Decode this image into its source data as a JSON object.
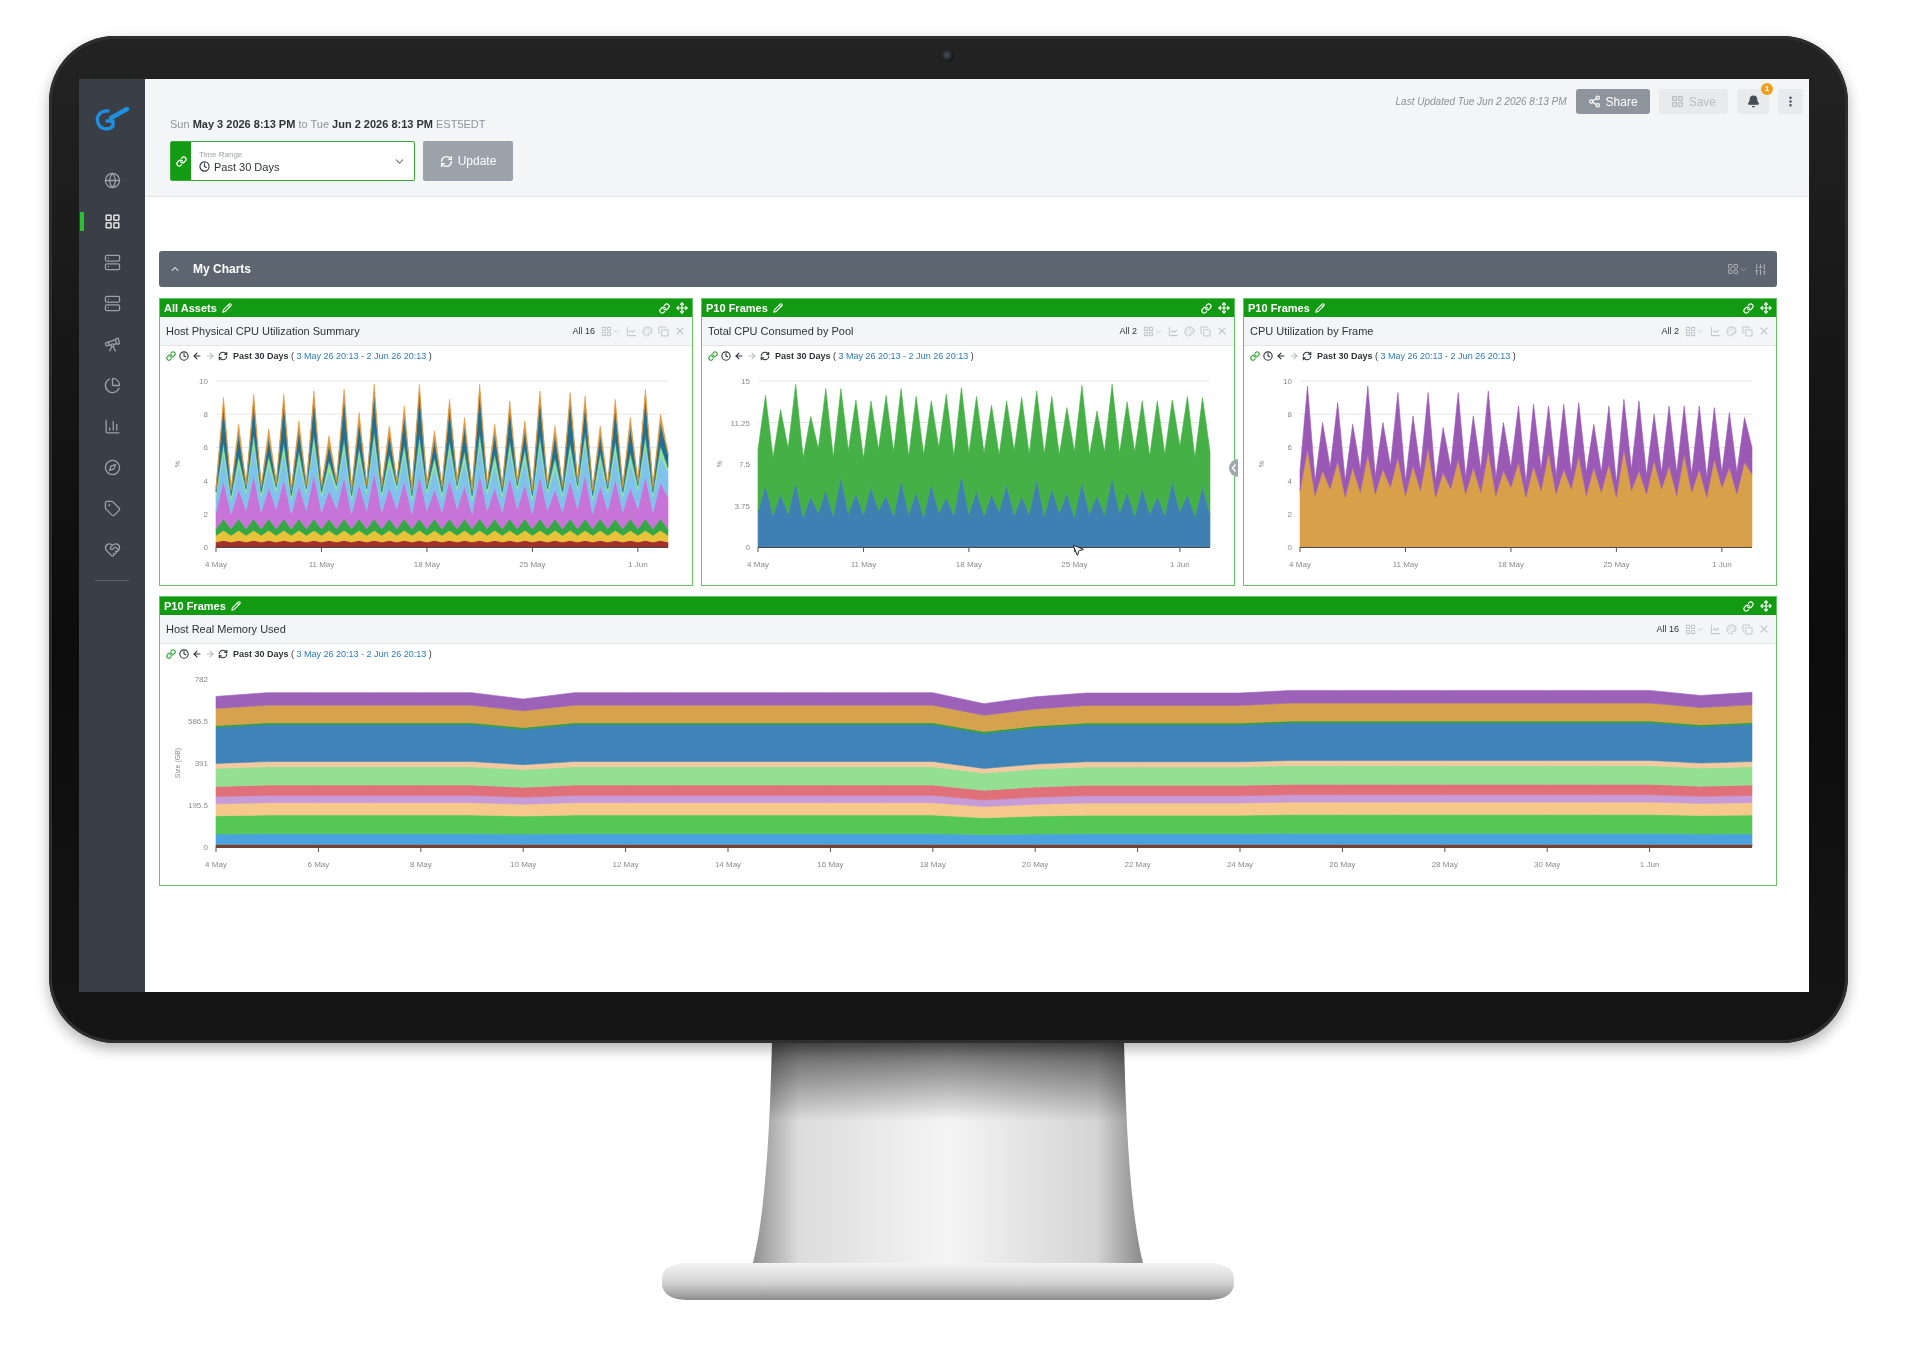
{
  "sidebar": {
    "items": [
      {
        "selected": false
      },
      {
        "selected": true
      },
      {
        "selected": false
      },
      {
        "selected": false
      },
      {
        "selected": false
      },
      {
        "selected": false
      },
      {
        "selected": false
      },
      {
        "selected": false
      },
      {
        "selected": false
      },
      {
        "selected": false
      }
    ]
  },
  "header": {
    "range_line": "Sun **May 3 2026 8:13 PM** to Tue **Jun 2 2026 8:13 PM** EST5EDT",
    "time_range": {
      "label": "Time Range",
      "value": "Past 30 Days"
    },
    "update_button": "Update",
    "last_updated": "Last Updated Tue Jun 2 2026 8:13 PM",
    "actions": [
      {
        "kind": "share",
        "label": "Share",
        "disabled": false
      },
      {
        "kind": "save",
        "label": "Save",
        "disabled": true
      }
    ],
    "notifications": {
      "count": "1"
    }
  },
  "section": {
    "title": "My Charts",
    "expanded": true
  },
  "panel_rows": [
    {
      "panels": [
        {
          "group": "All Assets",
          "title": "Host Physical CPU Utilization Summary",
          "filter": "All 16",
          "toolbar": {
            "period": "Past 30 Days",
            "brackets": [
              "(",
              ")"
            ],
            "dates": "3 May 26 20:13 - 2 Jun 26 20:13"
          },
          "chart_data": {
            "type": "area",
            "stacked": true,
            "grid": true,
            "ylabel": "%",
            "categories": [
              "4 May",
              null,
              null,
              null,
              null,
              null,
              null,
              null,
              null,
              null,
              null,
              null,
              null,
              null,
              "11 May",
              null,
              null,
              null,
              null,
              null,
              null,
              null,
              null,
              null,
              null,
              null,
              null,
              null,
              "18 May",
              null,
              null,
              null,
              null,
              null,
              null,
              null,
              null,
              null,
              null,
              null,
              null,
              null,
              "25 May",
              null,
              null,
              null,
              null,
              null,
              null,
              null,
              null,
              null,
              null,
              null,
              null,
              null,
              "1 Jun",
              null,
              null,
              null,
              null
            ],
            "ylim": [
              0,
              10
            ],
            "yticks": [
              0,
              2,
              4,
              6,
              8,
              10
            ],
            "series": [
              {
                "color": "#a3302a",
                "values": [
                  0.3,
                  0.4,
                  0.3,
                  0.4,
                  0.3,
                  0.4,
                  0.3,
                  0.4,
                  0.3,
                  0.4,
                  0.3,
                  0.4,
                  0.3,
                  0.4,
                  0.3,
                  0.4,
                  0.3,
                  0.4,
                  0.3,
                  0.4,
                  0.3,
                  0.4,
                  0.3,
                  0.4,
                  0.3,
                  0.4,
                  0.3,
                  0.4,
                  0.3,
                  0.4,
                  0.3,
                  0.4,
                  0.3,
                  0.4,
                  0.3,
                  0.4,
                  0.3,
                  0.4,
                  0.3,
                  0.4,
                  0.3,
                  0.4,
                  0.3,
                  0.4,
                  0.3,
                  0.4,
                  0.3,
                  0.4,
                  0.3,
                  0.4,
                  0.3,
                  0.4,
                  0.3,
                  0.4,
                  0.3,
                  0.4,
                  0.3,
                  0.4,
                  0.3,
                  0.4,
                  0.3
                ]
              },
              {
                "color": "#e8c33a",
                "values": [
                  0.4,
                  0.6,
                  0.4,
                  0.6,
                  0.4,
                  0.6,
                  0.4,
                  0.6,
                  0.4,
                  0.6,
                  0.4,
                  0.6,
                  0.4,
                  0.6,
                  0.4,
                  0.6,
                  0.4,
                  0.6,
                  0.4,
                  0.6,
                  0.4,
                  0.6,
                  0.4,
                  0.6,
                  0.4,
                  0.6,
                  0.4,
                  0.6,
                  0.4,
                  0.6,
                  0.4,
                  0.6,
                  0.4,
                  0.6,
                  0.4,
                  0.6,
                  0.4,
                  0.6,
                  0.4,
                  0.6,
                  0.4,
                  0.6,
                  0.4,
                  0.6,
                  0.4,
                  0.6,
                  0.4,
                  0.6,
                  0.4,
                  0.6,
                  0.4,
                  0.6,
                  0.4,
                  0.6,
                  0.4,
                  0.6,
                  0.4,
                  0.6,
                  0.4,
                  0.6,
                  0.4
                ]
              },
              {
                "color": "#35a845",
                "values": [
                  0.4,
                  0.7,
                  0.4,
                  0.7,
                  0.4,
                  0.7,
                  0.4,
                  0.7,
                  0.4,
                  0.7,
                  0.4,
                  0.7,
                  0.4,
                  0.7,
                  0.4,
                  0.7,
                  0.4,
                  0.7,
                  0.4,
                  0.7,
                  0.4,
                  0.7,
                  0.4,
                  0.7,
                  0.4,
                  0.7,
                  0.4,
                  0.7,
                  0.4,
                  0.7,
                  0.4,
                  0.7,
                  0.4,
                  0.7,
                  0.4,
                  0.7,
                  0.4,
                  0.7,
                  0.4,
                  0.7,
                  0.4,
                  0.7,
                  0.4,
                  0.7,
                  0.4,
                  0.7,
                  0.4,
                  0.7,
                  0.4,
                  0.7,
                  0.4,
                  0.7,
                  0.4,
                  0.7,
                  0.4,
                  0.7,
                  0.4,
                  0.7,
                  0.4,
                  0.7,
                  0.4
                ]
              },
              {
                "color": "#c873d8",
                "values": [
                  1.0,
                  2.3,
                  0.9,
                  1.8,
                  1.1,
                  2.6,
                  1.0,
                  1.9,
                  1.2,
                  2.4,
                  0.9,
                  2.0,
                  1.1,
                  2.7,
                  1.0,
                  1.7,
                  1.2,
                  2.5,
                  0.9,
                  2.1,
                  1.1,
                  2.8,
                  1.0,
                  1.9,
                  1.2,
                  2.3,
                  0.9,
                  2.6,
                  1.1,
                  1.8,
                  1.0,
                  2.4,
                  1.2,
                  2.0,
                  0.9,
                  2.7,
                  1.1,
                  1.9,
                  1.0,
                  2.5,
                  1.2,
                  2.1,
                  0.9,
                  2.6,
                  1.1,
                  1.8,
                  1.0,
                  2.3,
                  1.2,
                  2.7,
                  0.9,
                  2.0,
                  1.1,
                  2.4,
                  1.0,
                  1.9,
                  1.2,
                  2.6,
                  1.0,
                  2.2,
                  1.9
                ]
              },
              {
                "color": "#7fc3ec",
                "values": [
                  0.9,
                  1.7,
                  0.8,
                  1.4,
                  1.0,
                  1.9,
                  0.9,
                  1.3,
                  1.0,
                  1.6,
                  0.8,
                  1.5,
                  1.0,
                  1.8,
                  0.9,
                  1.2,
                  1.1,
                  1.7,
                  0.8,
                  1.6,
                  1.0,
                  1.9,
                  0.9,
                  1.4,
                  1.1,
                  1.6,
                  0.8,
                  1.8,
                  1.0,
                  1.3,
                  0.9,
                  1.7,
                  1.1,
                  1.5,
                  0.8,
                  1.9,
                  1.0,
                  1.4,
                  0.9,
                  1.6,
                  1.1,
                  1.5,
                  0.8,
                  1.8,
                  1.0,
                  1.3,
                  0.9,
                  1.7,
                  1.1,
                  1.9,
                  0.8,
                  1.4,
                  1.0,
                  1.7,
                  0.9,
                  1.5,
                  1.1,
                  1.8,
                  0.9,
                  1.6,
                  1.5
                ]
              },
              {
                "color": "#93e29a",
                "values": [
                  0.3,
                  0.6,
                  0.3,
                  0.6,
                  0.3,
                  0.6,
                  0.3,
                  0.6,
                  0.3,
                  0.6,
                  0.3,
                  0.6,
                  0.3,
                  0.6,
                  0.3,
                  0.6,
                  0.3,
                  0.6,
                  0.3,
                  0.6,
                  0.3,
                  0.6,
                  0.3,
                  0.6,
                  0.3,
                  0.6,
                  0.3,
                  0.6,
                  0.3,
                  0.6,
                  0.3,
                  0.6,
                  0.3,
                  0.6,
                  0.3,
                  0.6,
                  0.3,
                  0.6,
                  0.3,
                  0.6,
                  0.3,
                  0.6,
                  0.3,
                  0.6,
                  0.3,
                  0.6,
                  0.3,
                  0.6,
                  0.3,
                  0.6,
                  0.3,
                  0.6,
                  0.3,
                  0.6,
                  0.3,
                  0.6,
                  0.3,
                  0.6,
                  0.3,
                  0.6,
                  0.3
                ]
              },
              {
                "color": "#22708f",
                "values": [
                  0.2,
                  2.2,
                  0.3,
                  1.4,
                  0.2,
                  1.9,
                  0.3,
                  1.1,
                  0.2,
                  2.4,
                  0.3,
                  1.3,
                  0.2,
                  2.1,
                  0.3,
                  1.0,
                  0.2,
                  2.5,
                  0.3,
                  1.6,
                  0.2,
                  2.3,
                  0.3,
                  1.2,
                  0.2,
                  1.8,
                  0.3,
                  2.6,
                  0.2,
                  1.1,
                  0.3,
                  2.0,
                  0.2,
                  1.5,
                  0.3,
                  2.4,
                  0.2,
                  1.3,
                  0.3,
                  1.9,
                  0.2,
                  1.2,
                  0.3,
                  2.2,
                  0.2,
                  1.4,
                  0.3,
                  2.5,
                  0.2,
                  1.7,
                  0.3,
                  1.1,
                  0.2,
                  2.0,
                  0.3,
                  1.6,
                  0.2,
                  2.3,
                  0.3,
                  1.4,
                  0.8
                ]
              },
              {
                "color": "#e2973d",
                "values": [
                  0.1,
                  0.5,
                  0.1,
                  0.5,
                  0.1,
                  0.5,
                  0.1,
                  0.5,
                  0.1,
                  0.5,
                  0.1,
                  0.5,
                  0.1,
                  0.5,
                  0.1,
                  0.5,
                  0.1,
                  0.5,
                  0.1,
                  0.5,
                  0.1,
                  0.5,
                  0.1,
                  0.5,
                  0.1,
                  0.5,
                  0.1,
                  0.5,
                  0.1,
                  0.5,
                  0.1,
                  0.5,
                  0.1,
                  0.5,
                  0.1,
                  0.5,
                  0.1,
                  0.5,
                  0.1,
                  0.5,
                  0.1,
                  0.5,
                  0.1,
                  0.5,
                  0.1,
                  0.5,
                  0.1,
                  0.5,
                  0.1,
                  0.5,
                  0.1,
                  0.5,
                  0.1,
                  0.5,
                  0.1,
                  0.5,
                  0.1,
                  0.5,
                  0.1,
                  0.5,
                  0.1
                ]
              }
            ]
          }
        },
        {
          "group": "P10 Frames",
          "title": "Total CPU Consumed by Pool",
          "filter": "All 2",
          "toolbar": {
            "period": "Past 30 Days",
            "brackets": [
              "(",
              ")"
            ],
            "dates": "3 May 26 20:13 - 2 Jun 26 20:13"
          },
          "chart_data": {
            "type": "area",
            "stacked": true,
            "grid": true,
            "ylabel": "%",
            "categories": [
              "4 May",
              null,
              null,
              null,
              null,
              null,
              null,
              null,
              null,
              null,
              null,
              null,
              null,
              null,
              "11 May",
              null,
              null,
              null,
              null,
              null,
              null,
              null,
              null,
              null,
              null,
              null,
              null,
              null,
              "18 May",
              null,
              null,
              null,
              null,
              null,
              null,
              null,
              null,
              null,
              null,
              null,
              null,
              null,
              "25 May",
              null,
              null,
              null,
              null,
              null,
              null,
              null,
              null,
              null,
              null,
              null,
              null,
              null,
              "1 Jun",
              null,
              null,
              null,
              null
            ],
            "ylim": [
              0,
              15
            ],
            "yticks": [
              0,
              3.75,
              7.5,
              11.25,
              15
            ],
            "series": [
              {
                "color": "#3f80b3",
                "values": [
                  3.2,
                  5.6,
                  2.9,
                  4.8,
                  3.0,
                  5.9,
                  2.7,
                  4.6,
                  3.1,
                  5.2,
                  2.8,
                  6.4,
                  3.0,
                  4.9,
                  2.9,
                  5.5,
                  3.3,
                  4.7,
                  2.8,
                  6.1,
                  3.0,
                  5.0,
                  2.7,
                  5.8,
                  3.1,
                  4.5,
                  2.9,
                  6.6,
                  3.0,
                  5.1,
                  2.8,
                  4.8,
                  3.2,
                  5.7,
                  2.9,
                  4.6,
                  3.0,
                  6.2,
                  2.8,
                  5.3,
                  3.1,
                  4.9,
                  2.7,
                  5.9,
                  3.0,
                  4.7,
                  2.9,
                  6.3,
                  3.1,
                  5.0,
                  2.8,
                  5.4,
                  3.0,
                  4.6,
                  2.9,
                  6.0,
                  3.2,
                  4.8,
                  2.8,
                  5.5,
                  3.0
                ]
              },
              {
                "color": "#45b045",
                "values": [
                  5.6,
                  8.1,
                  5.2,
                  7.6,
                  5.9,
                  8.8,
                  5.4,
                  7.2,
                  5.8,
                  9.1,
                  5.3,
                  7.9,
                  5.7,
                  8.4,
                  5.1,
                  7.7,
                  5.5,
                  9.0,
                  5.8,
                  8.2,
                  5.2,
                  8.6,
                  5.6,
                  7.4,
                  5.9,
                  9.3,
                  5.3,
                  7.8,
                  5.5,
                  8.5,
                  5.7,
                  8.0,
                  5.1,
                  7.5,
                  5.8,
                  8.9,
                  5.4,
                  7.9,
                  5.6,
                  8.3,
                  5.2,
                  7.7,
                  5.9,
                  8.7,
                  5.3,
                  7.6,
                  5.7,
                  8.4,
                  5.4,
                  8.1,
                  5.8,
                  7.8,
                  5.2,
                  8.6,
                  5.5,
                  7.3,
                  5.9,
                  8.8,
                  5.3,
                  8.0,
                  5.6
                ]
              }
            ]
          }
        },
        {
          "group": "P10 Frames",
          "title": "CPU Utilization by Frame",
          "filter": "All 2",
          "toolbar": {
            "period": "Past 30 Days",
            "brackets": [
              "(",
              ")"
            ],
            "dates": "3 May 26 20:13 - 2 Jun 26 20:13"
          },
          "chart_data": {
            "type": "area",
            "stacked": true,
            "grid": true,
            "ylabel": "%",
            "categories": [
              "4 May",
              null,
              null,
              null,
              null,
              null,
              null,
              null,
              null,
              null,
              null,
              null,
              null,
              null,
              "11 May",
              null,
              null,
              null,
              null,
              null,
              null,
              null,
              null,
              null,
              null,
              null,
              null,
              null,
              "18 May",
              null,
              null,
              null,
              null,
              null,
              null,
              null,
              null,
              null,
              null,
              null,
              null,
              null,
              "25 May",
              null,
              null,
              null,
              null,
              null,
              null,
              null,
              null,
              null,
              null,
              null,
              null,
              null,
              "1 Jun",
              null,
              null,
              null,
              null
            ],
            "ylim": [
              0,
              10
            ],
            "yticks": [
              0,
              2,
              4,
              6,
              8,
              10
            ],
            "series": [
              {
                "color": "#d9a04a",
                "values": [
                  3.4,
                  5.9,
                  3.1,
                  4.6,
                  3.5,
                  5.2,
                  3.0,
                  4.8,
                  3.3,
                  5.6,
                  3.2,
                  4.7,
                  3.6,
                  5.4,
                  3.1,
                  4.9,
                  3.4,
                  6.0,
                  3.0,
                  4.5,
                  3.5,
                  5.3,
                  3.2,
                  4.8,
                  3.3,
                  5.8,
                  3.1,
                  4.6,
                  3.6,
                  5.1,
                  3.0,
                  4.9,
                  3.4,
                  5.7,
                  3.2,
                  4.7,
                  3.5,
                  5.5,
                  3.1,
                  4.8,
                  3.3,
                  5.0,
                  3.0,
                  5.9,
                  3.4,
                  4.6,
                  3.2,
                  5.2,
                  3.5,
                  4.9,
                  3.1,
                  5.6,
                  3.3,
                  4.7,
                  3.0,
                  5.3,
                  3.6,
                  4.8,
                  3.2,
                  5.1,
                  4.4
                ]
              },
              {
                "color": "#9b59b6",
                "values": [
                  1.2,
                  3.8,
                  0.9,
                  2.9,
                  1.3,
                  3.5,
                  1.0,
                  2.6,
                  1.4,
                  4.1,
                  1.1,
                  2.8,
                  1.3,
                  3.9,
                  0.9,
                  3.0,
                  1.2,
                  3.3,
                  1.0,
                  2.7,
                  1.3,
                  4.0,
                  1.0,
                  3.1,
                  1.4,
                  3.6,
                  1.1,
                  2.9,
                  1.2,
                  3.4,
                  0.9,
                  3.7,
                  1.3,
                  2.8,
                  1.1,
                  3.9,
                  1.0,
                  3.2,
                  1.4,
                  2.6,
                  1.2,
                  3.5,
                  0.9,
                  3.0,
                  1.3,
                  4.2,
                  1.1,
                  2.8,
                  1.0,
                  3.6,
                  1.4,
                  2.9,
                  1.1,
                  3.8,
                  1.2,
                  3.1,
                  0.9,
                  3.3,
                  1.3,
                  2.7,
                  1.6
                ]
              }
            ]
          }
        }
      ]
    },
    {
      "panels": [
        {
          "group": "P10 Frames",
          "title": "Host Real Memory Used",
          "filter": "All 16",
          "toolbar": {
            "period": "Past 30 Days",
            "brackets": [
              "(",
              ")"
            ],
            "dates": "3 May 26 20:13 - 2 Jun 26 20:13"
          },
          "chart_data": {
            "type": "area",
            "stacked": true,
            "ylabel": "Size (GB)",
            "categories": [
              "4 May",
              null,
              "6 May",
              null,
              "8 May",
              null,
              "10 May",
              null,
              "12 May",
              null,
              "14 May",
              null,
              "16 May",
              null,
              "18 May",
              null,
              "20 May",
              null,
              "22 May",
              null,
              "24 May",
              null,
              "26 May",
              null,
              "28 May",
              null,
              "30 May",
              null,
              "1 Jun",
              null,
              null
            ],
            "ylim": [
              0,
              782
            ],
            "yticks": [
              0,
              195.5,
              391,
              586.5,
              782
            ],
            "series": [
              {
                "color": "#8b3a1a",
                "values": [
                  12,
                  12,
                  12,
                  12,
                  12,
                  12,
                  12,
                  12,
                  12,
                  12,
                  12,
                  12,
                  12,
                  12,
                  12,
                  12,
                  12,
                  12,
                  12,
                  12,
                  12,
                  12,
                  12,
                  12,
                  12,
                  12,
                  12,
                  12,
                  12,
                  12,
                  12
                ]
              },
              {
                "color": "#4aa3df",
                "values": [
                  48,
                  50,
                  50,
                  50,
                  50,
                  50,
                  48,
                  50,
                  50,
                  50,
                  50,
                  50,
                  50,
                  50,
                  50,
                  46,
                  48,
                  50,
                  50,
                  50,
                  50,
                  51,
                  51,
                  51,
                  51,
                  51,
                  51,
                  51,
                  51,
                  49,
                  50
                ]
              },
              {
                "color": "#55c755",
                "values": [
                  85,
                  87,
                  87,
                  87,
                  87,
                  87,
                  84,
                  87,
                  87,
                  87,
                  87,
                  87,
                  87,
                  87,
                  87,
                  78,
                  84,
                  86,
                  86,
                  86,
                  86,
                  88,
                  88,
                  88,
                  88,
                  88,
                  88,
                  88,
                  88,
                  86,
                  87
                ]
              },
              {
                "color": "#f6c88a",
                "values": [
                  56,
                  57,
                  57,
                  57,
                  57,
                  57,
                  55,
                  57,
                  57,
                  57,
                  57,
                  57,
                  57,
                  57,
                  57,
                  52,
                  55,
                  57,
                  57,
                  57,
                  57,
                  58,
                  58,
                  58,
                  58,
                  58,
                  58,
                  58,
                  58,
                  56,
                  57
                ]
              },
              {
                "color": "#c79ad8",
                "values": [
                  34,
                  34,
                  34,
                  34,
                  34,
                  34,
                  33,
                  34,
                  34,
                  34,
                  34,
                  34,
                  34,
                  34,
                  34,
                  31,
                  33,
                  34,
                  34,
                  34,
                  34,
                  34,
                  34,
                  34,
                  34,
                  34,
                  34,
                  34,
                  34,
                  33,
                  34
                ]
              },
              {
                "color": "#e0707a",
                "values": [
                  47,
                  48,
                  48,
                  48,
                  48,
                  48,
                  46,
                  48,
                  48,
                  48,
                  48,
                  48,
                  48,
                  48,
                  48,
                  45,
                  47,
                  48,
                  48,
                  48,
                  48,
                  49,
                  49,
                  49,
                  49,
                  49,
                  49,
                  49,
                  49,
                  47,
                  48
                ]
              },
              {
                "color": "#93e093",
                "values": [
                  85,
                  86,
                  86,
                  86,
                  86,
                  86,
                  83,
                  86,
                  86,
                  86,
                  86,
                  86,
                  86,
                  86,
                  86,
                  80,
                  84,
                  86,
                  86,
                  86,
                  86,
                  87,
                  87,
                  87,
                  87,
                  87,
                  87,
                  87,
                  87,
                  85,
                  86
                ]
              },
              {
                "color": "#f3c9a0",
                "values": [
                  22,
                  24,
                  24,
                  24,
                  24,
                  24,
                  22,
                  24,
                  24,
                  24,
                  24,
                  24,
                  24,
                  24,
                  24,
                  22,
                  23,
                  24,
                  24,
                  24,
                  24,
                  24,
                  24,
                  24,
                  24,
                  24,
                  24,
                  24,
                  24,
                  23,
                  24
                ]
              },
              {
                "color": "#3f84b8",
                "values": [
                  168,
                  172,
                  172,
                  172,
                  172,
                  172,
                  165,
                  172,
                  172,
                  172,
                  172,
                  172,
                  172,
                  172,
                  172,
                  163,
                  169,
                  172,
                  172,
                  172,
                  172,
                  175,
                  175,
                  175,
                  175,
                  175,
                  175,
                  175,
                  175,
                  170,
                  173
                ]
              },
              {
                "color": "#2f9e3a",
                "values": [
                  8,
                  8,
                  8,
                  8,
                  8,
                  8,
                  8,
                  8,
                  8,
                  8,
                  8,
                  8,
                  8,
                  8,
                  8,
                  8,
                  8,
                  8,
                  8,
                  8,
                  8,
                  8,
                  8,
                  8,
                  8,
                  8,
                  8,
                  8,
                  8,
                  8,
                  8
                ]
              },
              {
                "color": "#d6a24e",
                "values": [
                  80,
                  82,
                  82,
                  82,
                  82,
                  82,
                  78,
                  82,
                  82,
                  82,
                  82,
                  82,
                  82,
                  82,
                  82,
                  76,
                  80,
                  82,
                  82,
                  82,
                  82,
                  84,
                  84,
                  84,
                  84,
                  84,
                  84,
                  84,
                  84,
                  80,
                  83
                ]
              },
              {
                "color": "#9b62b8",
                "values": [
                  56,
                  58,
                  58,
                  58,
                  58,
                  58,
                  55,
                  58,
                  58,
                  58,
                  58,
                  58,
                  58,
                  58,
                  58,
                  54,
                  56,
                  58,
                  58,
                  58,
                  58,
                  59,
                  59,
                  59,
                  59,
                  59,
                  59,
                  59,
                  59,
                  56,
                  58
                ]
              }
            ]
          }
        }
      ]
    }
  ]
}
